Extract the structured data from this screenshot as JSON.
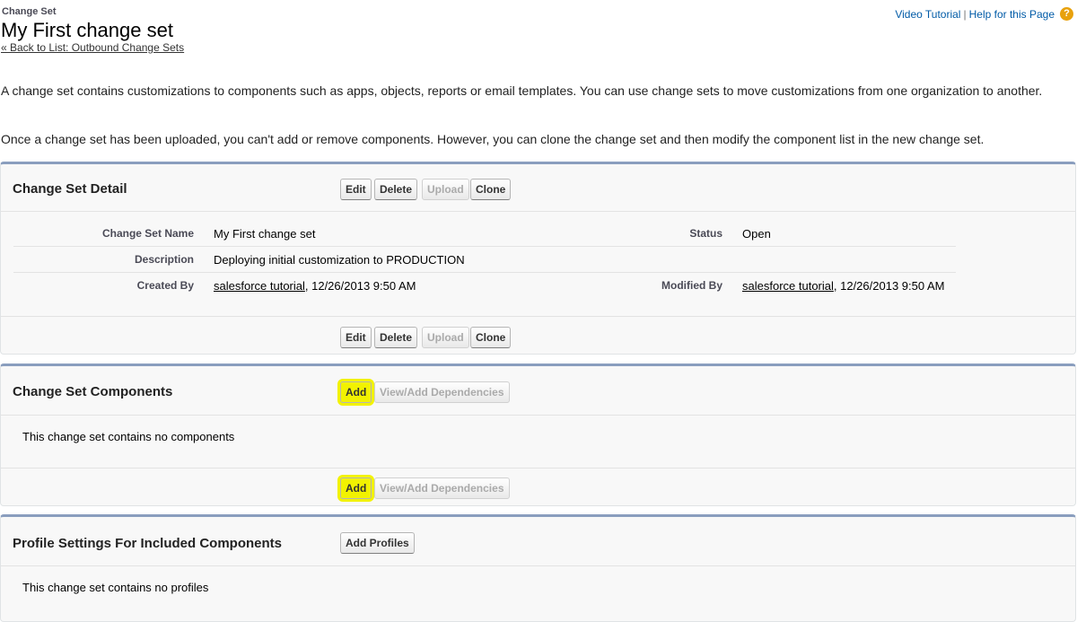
{
  "header": {
    "type_label": "Change Set",
    "title": "My First change set",
    "back_link": "« Back to List: Outbound Change Sets",
    "video_tutorial": "Video Tutorial",
    "separator": "|",
    "help_link": "Help for this Page",
    "help_icon": "question-mark-icon"
  },
  "intro": {
    "p1": "A change set contains customizations to components such as apps, objects, reports or email templates. You can use change sets to move customizations from one organization to another.",
    "p2": "Once a change set has been uploaded, you can't add or remove components. However, you can clone the change set and then modify the component list in the new change set."
  },
  "detail": {
    "title": "Change Set Detail",
    "buttons": {
      "edit": "Edit",
      "delete": "Delete",
      "upload": "Upload",
      "clone": "Clone"
    },
    "fields": {
      "name_label": "Change Set Name",
      "name_value": "My First change set",
      "status_label": "Status",
      "status_value": "Open",
      "description_label": "Description",
      "description_value": "Deploying initial customization to PRODUCTION",
      "created_by_label": "Created By",
      "created_by_user": "salesforce tutorial",
      "created_by_date": ", 12/26/2013 9:50 AM",
      "modified_by_label": "Modified By",
      "modified_by_user": "salesforce tutorial",
      "modified_by_date": ", 12/26/2013 9:50 AM"
    }
  },
  "components": {
    "title": "Change Set Components",
    "add": "Add",
    "view_deps": "View/Add Dependencies",
    "empty": "This change set contains no components"
  },
  "profiles": {
    "title": "Profile Settings For Included Components",
    "add_profiles": "Add Profiles",
    "empty": "This change set contains no profiles"
  },
  "colors": {
    "highlight": "#f2f200",
    "link": "#015ba7",
    "block_border": "#8a9ebe"
  }
}
